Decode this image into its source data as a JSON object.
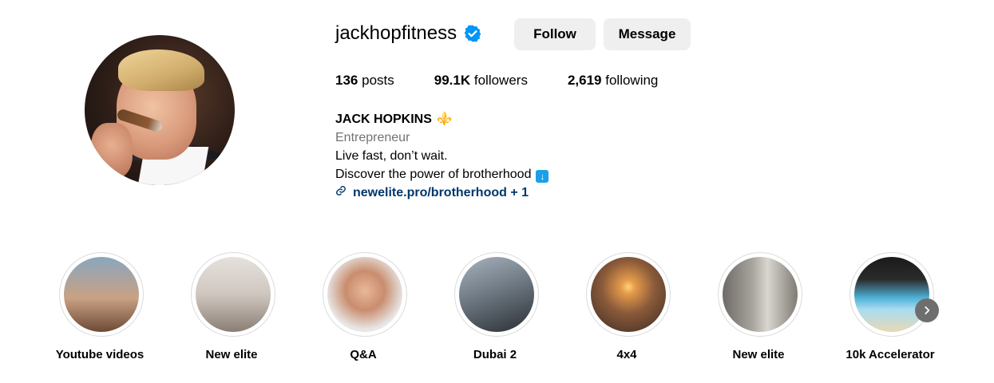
{
  "profile": {
    "username": "jackhopfitness",
    "verified": true,
    "follow_label": "Follow",
    "message_label": "Message"
  },
  "stats": [
    {
      "count": "136",
      "label": "posts"
    },
    {
      "count": "99.1K",
      "label": "followers"
    },
    {
      "count": "2,619",
      "label": "following"
    }
  ],
  "bio": {
    "name": "JACK HOPKINS",
    "name_emoji": "⚜️",
    "category": "Entrepreneur",
    "line1": "Live fast, don’t wait.",
    "line2": "Discover the power of brotherhood",
    "line2_emoji": "⬇️",
    "link_text": "newelite.pro/brotherhood + 1"
  },
  "highlights": [
    {
      "label": "Youtube videos"
    },
    {
      "label": "New elite"
    },
    {
      "label": "Q&A"
    },
    {
      "label": "Dubai 2"
    },
    {
      "label": "4x4"
    },
    {
      "label": "New elite"
    },
    {
      "label": "10k Accelerator"
    }
  ],
  "colors": {
    "verified_blue": "#0095f6",
    "link_color": "#00376b",
    "button_bg": "#efefef"
  },
  "icons": {
    "verified": "verified-badge-icon",
    "link": "link-icon",
    "next": "chevron-right-icon"
  }
}
